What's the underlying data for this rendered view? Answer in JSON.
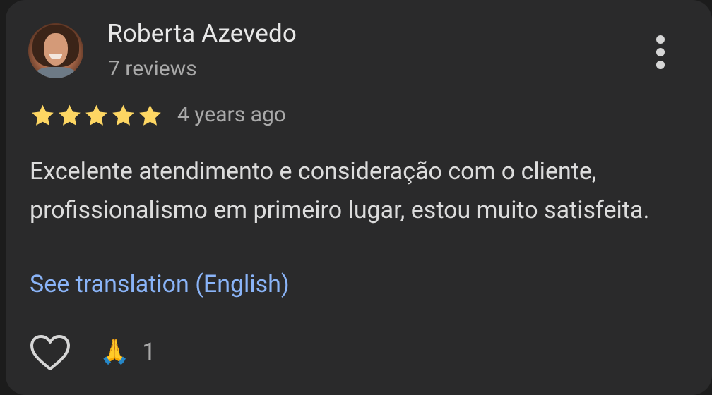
{
  "review": {
    "author_name": "Roberta Azevedo",
    "review_count": "7 reviews",
    "rating": 5,
    "max_rating": 5,
    "date": "4 years ago",
    "text": "Excelente atendimento e consideração com o cliente, profissionalismo em primeiro lugar, estou muito satisfeita.",
    "translation_link": "See translation (English)",
    "reaction_emoji": "🙏",
    "reaction_count": "1"
  },
  "icons": {
    "more": "more-vertical-icon",
    "star": "star-icon",
    "like": "heart-outline-icon"
  },
  "colors": {
    "card_background": "#2a2a2b",
    "star": "#fdd663",
    "link": "#8ab4f8",
    "primary_text": "#e8e8e8",
    "secondary_text": "#a9a9a9"
  }
}
